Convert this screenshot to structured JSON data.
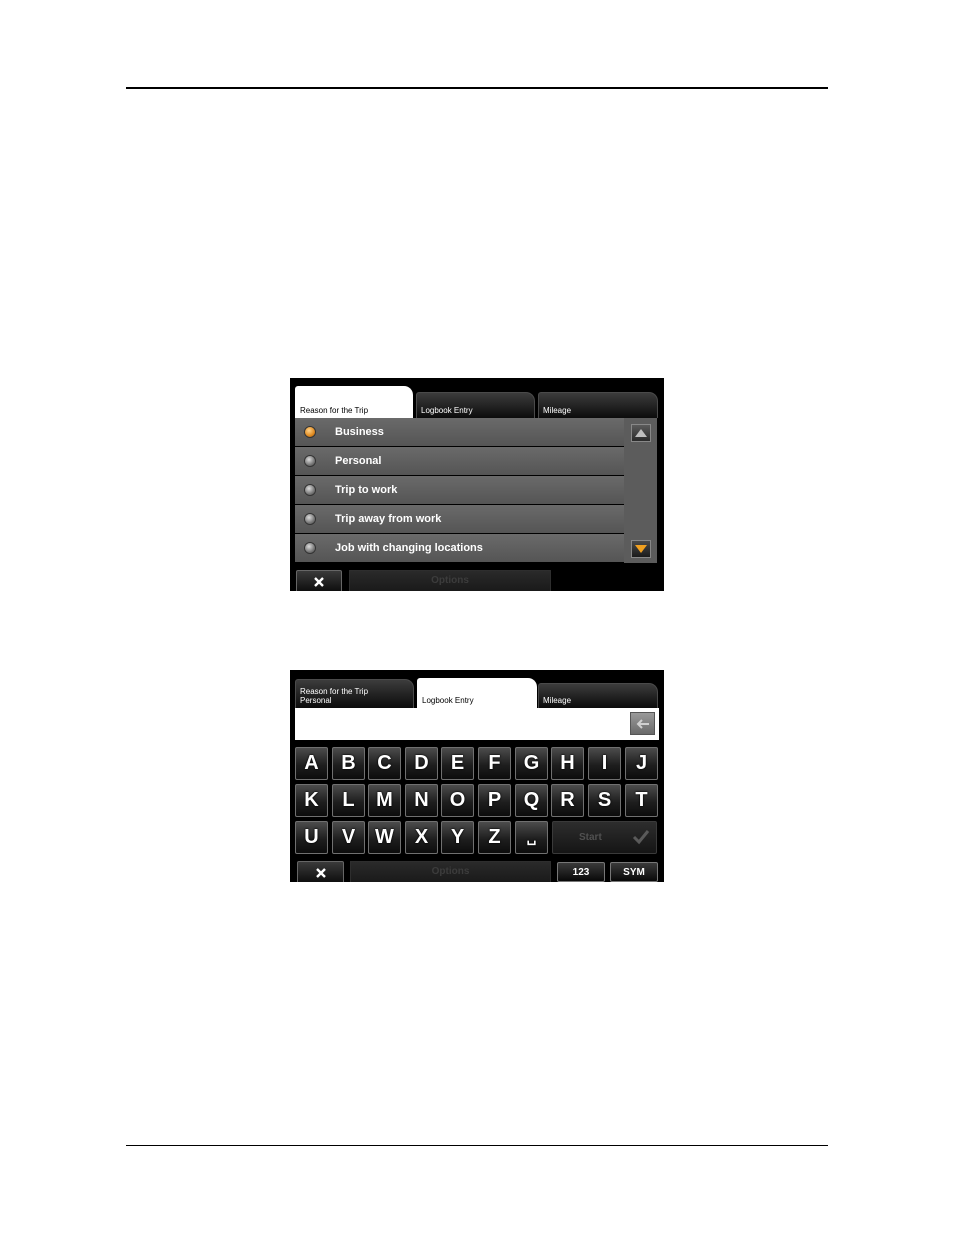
{
  "screen1": {
    "tabs": [
      {
        "line1": "Reason for the Trip",
        "line2": ""
      },
      {
        "line1": "Logbook Entry",
        "line2": ""
      },
      {
        "line1": "Mileage",
        "line2": ""
      }
    ],
    "options": [
      "Business",
      "Personal",
      "Trip to work",
      "Trip away from work",
      "Job with changing locations"
    ],
    "selected_index": 0,
    "options_label": "Options"
  },
  "screen2": {
    "tabs": [
      {
        "line1": "Reason for the Trip",
        "line2": "Personal"
      },
      {
        "line1": "Logbook Entry",
        "line2": ""
      },
      {
        "line1": "Mileage",
        "line2": ""
      }
    ],
    "input_value": "",
    "keys_row1": [
      "A",
      "B",
      "C",
      "D",
      "E",
      "F",
      "G",
      "H",
      "I",
      "J"
    ],
    "keys_row2": [
      "K",
      "L",
      "M",
      "N",
      "O",
      "P",
      "Q",
      "R",
      "S",
      "T"
    ],
    "keys_row3": [
      "U",
      "V",
      "W",
      "X",
      "Y",
      "Z",
      "␣"
    ],
    "start_label": "Start",
    "options_label": "Options",
    "numeric_label": "123",
    "symbol_label": "SYM"
  },
  "colors": {
    "accent": "#e08a20",
    "row_bg": "#5f5f5f",
    "screen_bg": "#000000"
  }
}
